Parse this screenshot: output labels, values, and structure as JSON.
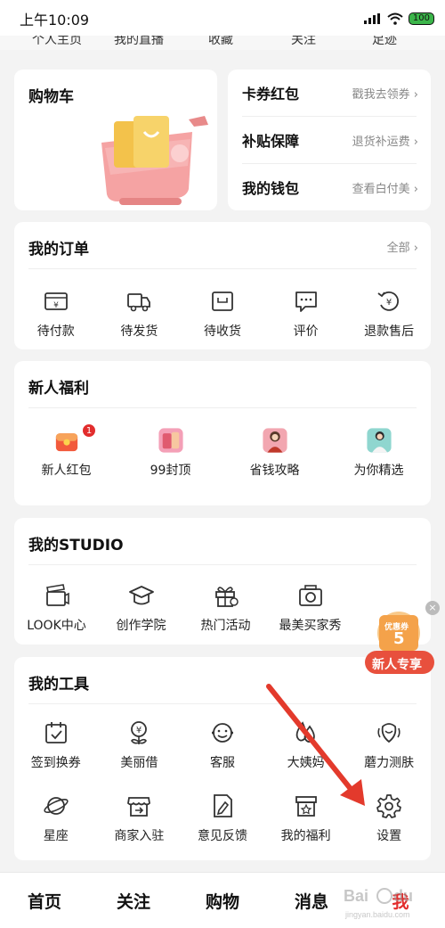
{
  "status_bar": {
    "time": "上午10:09",
    "battery": "100"
  },
  "top_links": [
    "个人主页",
    "我的直播",
    "收藏",
    "关注",
    "足迹"
  ],
  "cart": {
    "title": "购物车"
  },
  "side_rows": [
    {
      "label": "卡券红包",
      "link": "戳我去领券"
    },
    {
      "label": "补贴保障",
      "link": "退货补运费"
    },
    {
      "label": "我的钱包",
      "link": "查看白付美"
    }
  ],
  "orders": {
    "title": "我的订单",
    "link": "全部",
    "items": [
      {
        "label": "待付款",
        "icon": "wallet-icon"
      },
      {
        "label": "待发货",
        "icon": "truck-icon"
      },
      {
        "label": "待收货",
        "icon": "package-icon"
      },
      {
        "label": "评价",
        "icon": "comment-icon"
      },
      {
        "label": "退款售后",
        "icon": "refund-icon"
      }
    ]
  },
  "welfare": {
    "title": "新人福利",
    "items": [
      {
        "label": "新人红包",
        "badge": "1"
      },
      {
        "label": "99封顶"
      },
      {
        "label": "省钱攻略"
      },
      {
        "label": "为你精选"
      }
    ]
  },
  "studio": {
    "title": "我的STUDIO",
    "items": [
      {
        "label": "LOOK中心",
        "icon": "clapper-icon"
      },
      {
        "label": "创作学院",
        "icon": "graduation-cap-icon"
      },
      {
        "label": "热门活动",
        "icon": "gift-icon"
      },
      {
        "label": "最美买家秀",
        "icon": "camera-icon"
      }
    ]
  },
  "tools": {
    "title": "我的工具",
    "row1": [
      {
        "label": "签到换券",
        "icon": "calendar-check-icon"
      },
      {
        "label": "美丽借",
        "icon": "yen-flower-icon"
      },
      {
        "label": "客服",
        "icon": "headset-icon"
      },
      {
        "label": "大姨妈",
        "icon": "drop-icon"
      },
      {
        "label": "蘑力测肤",
        "icon": "face-icon"
      }
    ],
    "row2": [
      {
        "label": "星座",
        "icon": "planet-icon"
      },
      {
        "label": "商家入驻",
        "icon": "shop-icon"
      },
      {
        "label": "意见反馈",
        "icon": "feedback-icon"
      },
      {
        "label": "我的福利",
        "icon": "gift-box-icon"
      },
      {
        "label": "设置",
        "icon": "gear-icon"
      }
    ]
  },
  "float_badge": {
    "coupon": "优惠券",
    "amount": "5",
    "text": "新人专享"
  },
  "bottom_nav": [
    "首页",
    "关注",
    "购物",
    "消息",
    "我"
  ],
  "watermark": {
    "text": "Bai du 经验",
    "url": "jingyan.baidu.com"
  },
  "colors": {
    "accent": "#e22d2d",
    "card": "#ffffff",
    "bg": "#f3f3f3"
  }
}
